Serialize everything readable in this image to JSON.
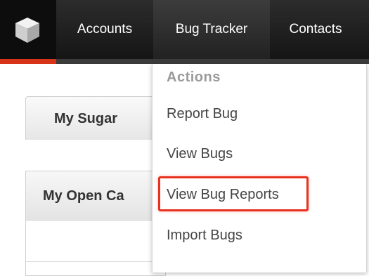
{
  "navbar": {
    "logo_icon": "cube-logo-icon",
    "items": [
      {
        "label": "Accounts"
      },
      {
        "label": "Bug Tracker"
      },
      {
        "label": "Contacts"
      }
    ]
  },
  "page": {
    "tab_label": "My Sugar",
    "panel_title": "My Open Ca"
  },
  "dropdown": {
    "header": "Actions",
    "items": [
      {
        "label": "Report Bug"
      },
      {
        "label": "View Bugs"
      },
      {
        "label": "View Bug Reports"
      },
      {
        "label": "Import Bugs"
      }
    ]
  },
  "colors": {
    "nav_bg": "#1e1e1e",
    "accent_red": "#d8341a",
    "highlight": "#e8321f"
  }
}
